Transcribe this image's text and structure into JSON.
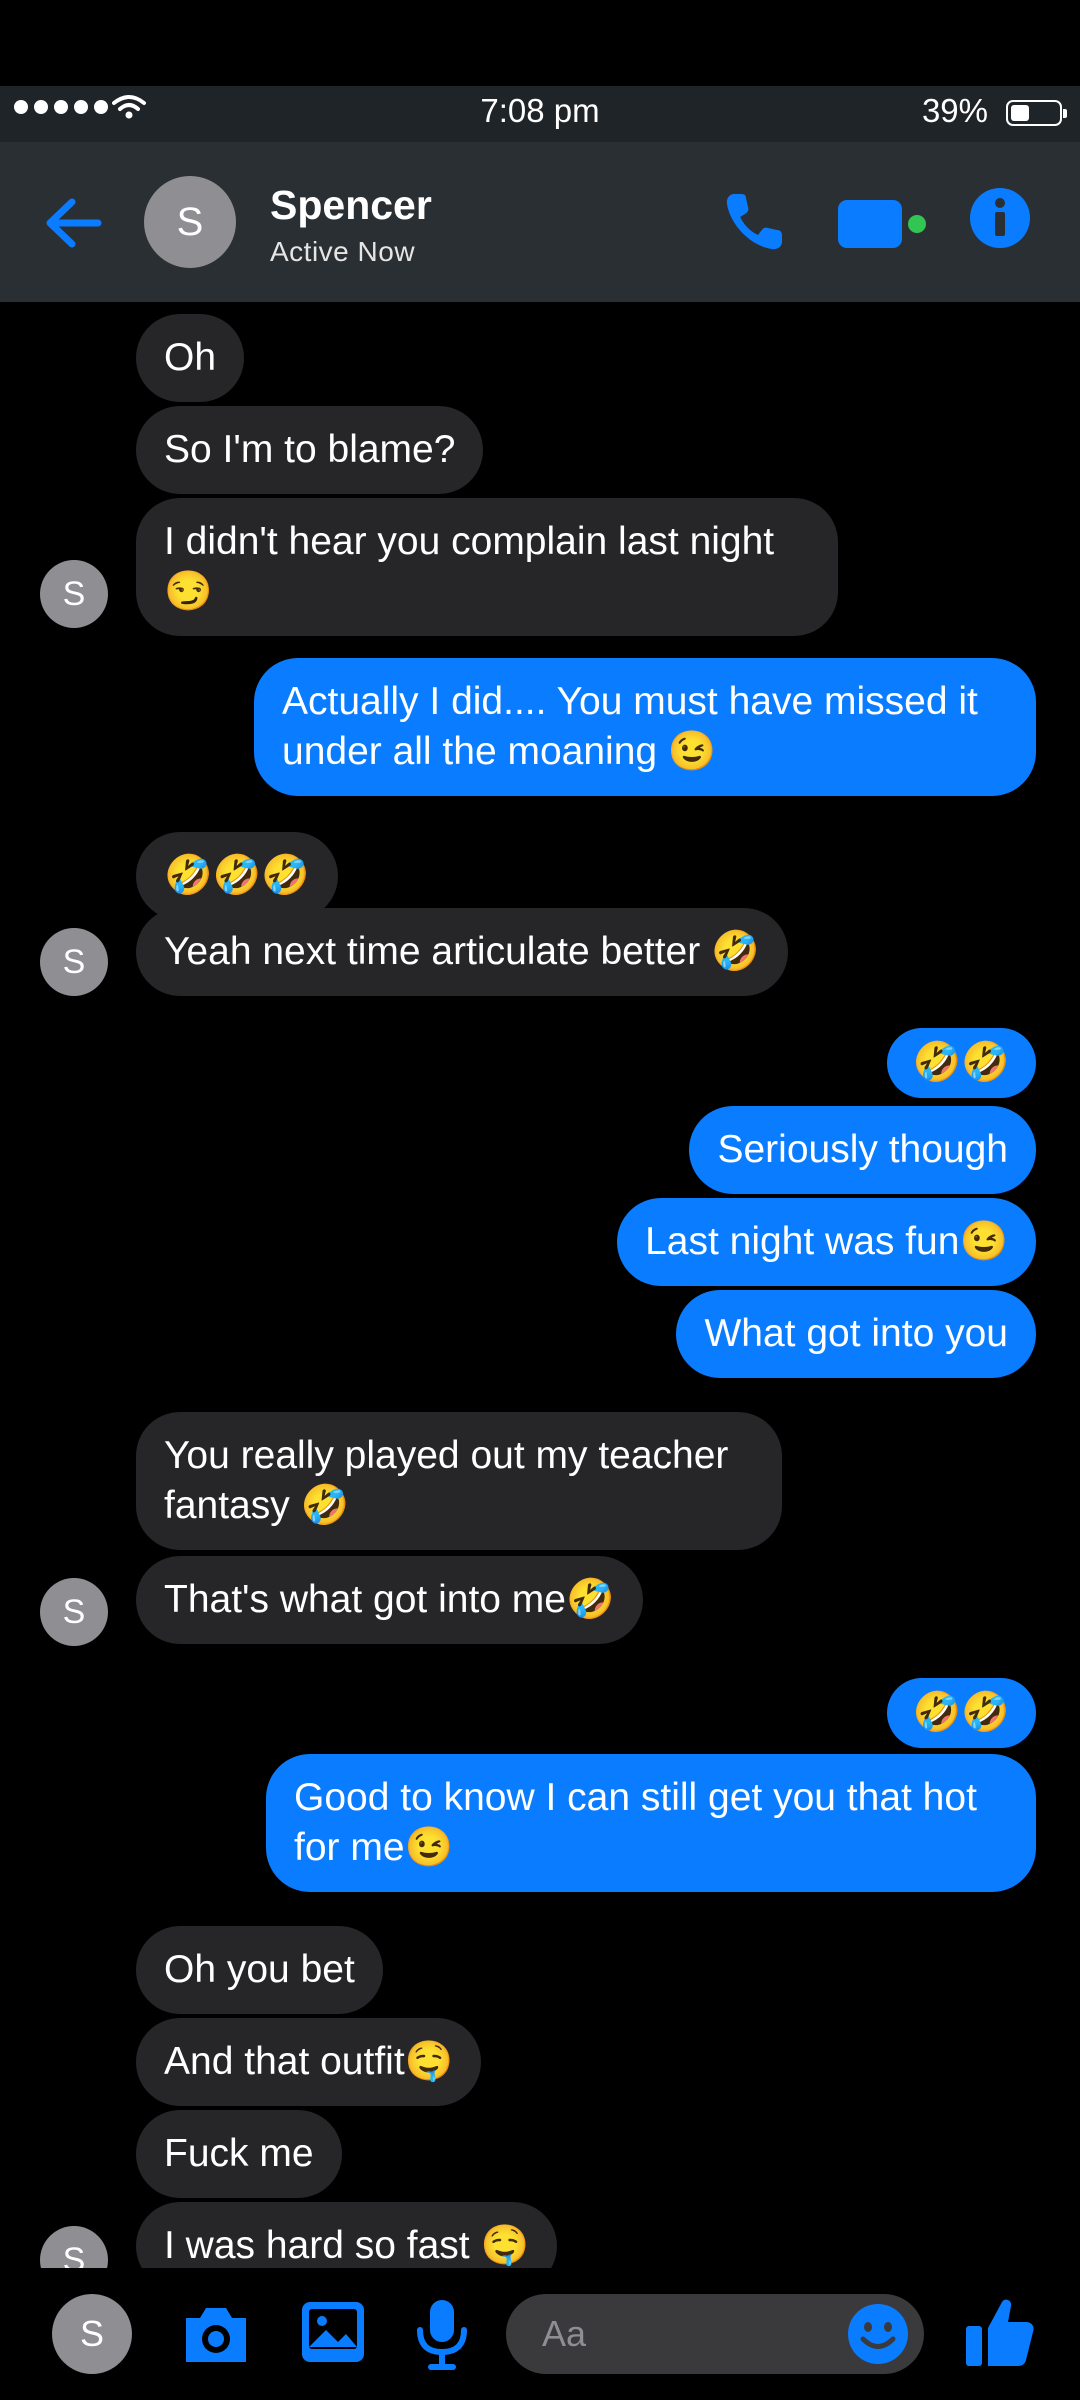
{
  "status_bar": {
    "time": "7:08 pm",
    "battery": "39%"
  },
  "header": {
    "name": "Spencer",
    "status": "Active Now",
    "avatar_letter": "S"
  },
  "colors": {
    "accent": "#0a7cff",
    "incoming_bubble": "#262629",
    "header_bg": "#2a2f33",
    "video_dot": "#31c553"
  },
  "messages": [
    {
      "from": "them",
      "text": "Oh"
    },
    {
      "from": "them",
      "text": "So I'm to blame?"
    },
    {
      "from": "them",
      "text": "I didn't hear you complain last night 😏"
    },
    {
      "from": "me",
      "text": "Actually I did.... You must have missed it under all the moaning 😉"
    },
    {
      "from": "them",
      "text": "🤣🤣🤣"
    },
    {
      "from": "them",
      "text": "Yeah next time articulate better 🤣"
    },
    {
      "from": "me",
      "text": "🤣🤣"
    },
    {
      "from": "me",
      "text": "Seriously though"
    },
    {
      "from": "me",
      "text": "Last night was fun😉"
    },
    {
      "from": "me",
      "text": "What got into you"
    },
    {
      "from": "them",
      "text": "You really played out my teacher fantasy 🤣"
    },
    {
      "from": "them",
      "text": "That's what got into me🤣"
    },
    {
      "from": "me",
      "text": "🤣🤣"
    },
    {
      "from": "me",
      "text": "Good to know I can still get you that hot for me😉"
    },
    {
      "from": "them",
      "text": "Oh you bet"
    },
    {
      "from": "them",
      "text": "And that outfit🤤"
    },
    {
      "from": "them",
      "text": "Fuck me"
    },
    {
      "from": "them",
      "text": "I was hard so fast 🤤"
    }
  ],
  "composer": {
    "placeholder": "Aa",
    "avatar_letter": "S"
  },
  "icons": [
    "back-arrow-icon",
    "phone-icon",
    "video-camera-icon",
    "info-icon",
    "camera-icon",
    "image-icon",
    "microphone-icon",
    "emoji-icon",
    "thumbs-up-icon",
    "wifi-icon",
    "battery-icon"
  ]
}
